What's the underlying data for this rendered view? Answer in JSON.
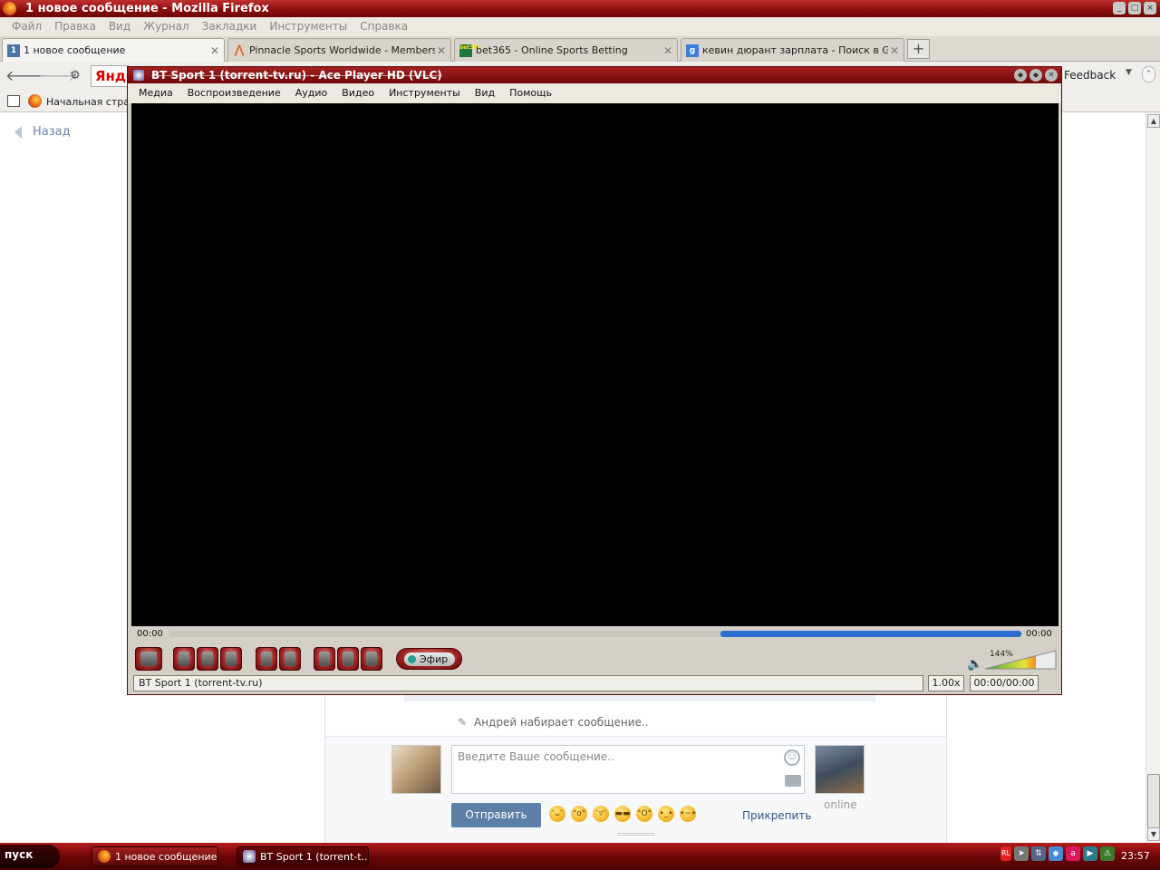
{
  "firefox": {
    "window_title": "1 новое сообщение - Mozilla Firefox",
    "menu": [
      "Файл",
      "Правка",
      "Вид",
      "Журнал",
      "Закладки",
      "Инструменты",
      "Справка"
    ],
    "tabs": [
      {
        "label": "1 новое сообщение",
        "favicon": "1"
      },
      {
        "label": "Pinnacle Sports Worldwide - Members Area",
        "favicon": ""
      },
      {
        "label": "bet365 - Online Sports Betting",
        "favicon": "bet365"
      },
      {
        "label": "кевин дюрант зарплата - Поиск в Goo...",
        "favicon": "g"
      }
    ],
    "new_tab": "+",
    "url_partial": "Янде",
    "feedback": "Feedback",
    "bookmark_label": "Начальная страница"
  },
  "page": {
    "back_label": "Назад",
    "typing_status": "Андрей набирает сообщение..",
    "message_placeholder": "Введите Ваше сообщение..",
    "send_label": "Отправить",
    "attach_label": "Прикрепить",
    "online_label": "online"
  },
  "player": {
    "window_title": "BT Sport 1 (torrent-tv.ru) - Ace Player HD (VLC)",
    "menu": [
      "Медиа",
      "Воспроизведение",
      "Аудио",
      "Видео",
      "Инструменты",
      "Вид",
      "Помощь"
    ],
    "time_elapsed": "00:00",
    "time_total": "00:00",
    "live_label": "Эфир",
    "volume_pct": "144%",
    "status_text": "BT Sport 1 (torrent-tv.ru)",
    "rate": "1.00x",
    "duration": "00:00/00:00"
  },
  "taskbar": {
    "start_label": "пуск",
    "items": [
      "1 новое сообщение...",
      "BT Sport 1 (torrent-t..."
    ],
    "lang": "RL",
    "clock": "23:57"
  }
}
